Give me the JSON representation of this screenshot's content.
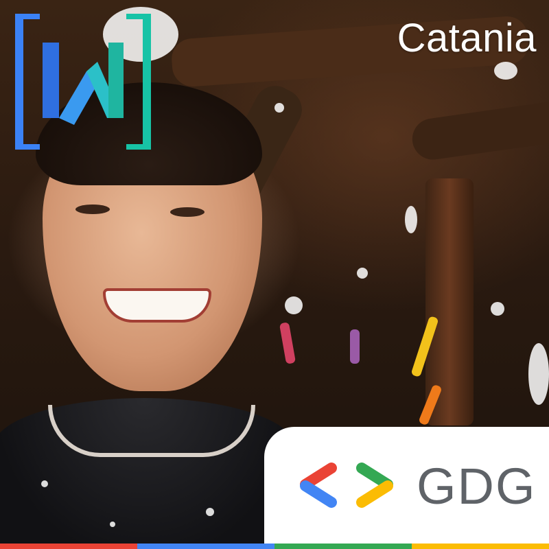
{
  "city_label": "Catania",
  "badge": {
    "text": "GDG"
  },
  "colors": {
    "google_red": "#ea4335",
    "google_blue": "#4285f4",
    "google_green": "#34a853",
    "google_yellow": "#fbbc04",
    "logo_blue": "#3b82f6",
    "logo_teal": "#17c3a6",
    "gdg_text": "#5f6368"
  },
  "icons": {
    "w_logo": "w-bracket-logo-icon",
    "gdg_logo": "gdg-chevrons-icon"
  }
}
